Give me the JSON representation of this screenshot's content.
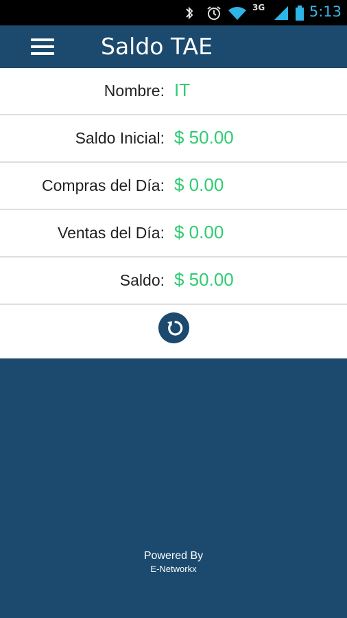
{
  "status_bar": {
    "time": "5:13",
    "network": "3G",
    "icons": [
      "bluetooth-icon",
      "alarm-icon",
      "wifi-icon",
      "signal-icon",
      "battery-icon"
    ]
  },
  "app_bar": {
    "title": "Saldo TAE",
    "menu_icon": "hamburger-menu-icon"
  },
  "fields": [
    {
      "label": "Nombre:",
      "value": "IT"
    },
    {
      "label": "Saldo Inicial:",
      "value": "$ 50.00"
    },
    {
      "label": "Compras del Día:",
      "value": "$ 0.00"
    },
    {
      "label": "Ventas del Día:",
      "value": "$ 0.00"
    },
    {
      "label": "Saldo:",
      "value": "$ 50.00"
    }
  ],
  "refresh": {
    "icon": "refresh-icon"
  },
  "footer": {
    "line1": "Powered By",
    "line2": "E-Networkx"
  },
  "colors": {
    "primary": "#1c4a6e",
    "value_green": "#2ecc71",
    "status_accent": "#37b6e9"
  }
}
